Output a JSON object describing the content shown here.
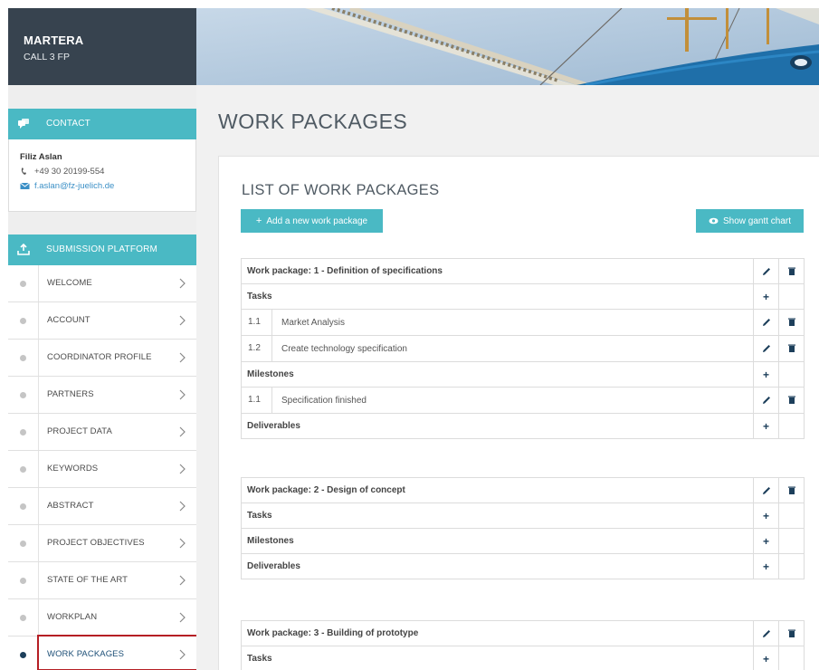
{
  "brand": {
    "title": "MARTERA",
    "subtitle": "CALL 3 FP"
  },
  "contact": {
    "header": "CONTACT",
    "name": "Filiz Aslan",
    "phone": "+49 30 20199-554",
    "email": "f.aslan@fz-juelich.de"
  },
  "submission": {
    "header": "SUBMISSION PLATFORM",
    "items": [
      {
        "label": "WELCOME",
        "active": false
      },
      {
        "label": "ACCOUNT",
        "active": false
      },
      {
        "label": "COORDINATOR PROFILE",
        "active": false
      },
      {
        "label": "PARTNERS",
        "active": false
      },
      {
        "label": "PROJECT DATA",
        "active": false
      },
      {
        "label": "KEYWORDS",
        "active": false
      },
      {
        "label": "ABSTRACT",
        "active": false
      },
      {
        "label": "PROJECT OBJECTIVES",
        "active": false
      },
      {
        "label": "STATE OF THE ART",
        "active": false
      },
      {
        "label": "WORKPLAN",
        "active": false
      },
      {
        "label": "WORK PACKAGES",
        "active": true
      }
    ]
  },
  "main": {
    "page_title": "WORK PACKAGES",
    "list_title": "LIST OF WORK PACKAGES",
    "add_button": "Add a new work package",
    "gantt_button": "Show gantt chart",
    "work_packages": [
      {
        "title": "Work package: 1 - Definition of specifications",
        "tasks_label": "Tasks",
        "tasks": [
          {
            "num": "1.1",
            "name": "Market Analysis"
          },
          {
            "num": "1.2",
            "name": "Create technology specification"
          }
        ],
        "milestones_label": "Milestones",
        "milestones": [
          {
            "num": "1.1",
            "name": "Specification finished"
          }
        ],
        "deliverables_label": "Deliverables"
      },
      {
        "title": "Work package: 2 - Design of concept",
        "tasks_label": "Tasks",
        "milestones_label": "Milestones",
        "deliverables_label": "Deliverables"
      },
      {
        "title": "Work package: 3 - Building of prototype",
        "tasks_label": "Tasks"
      }
    ]
  },
  "colors": {
    "accent": "#4ab9c4",
    "brand_bg": "#37434f",
    "icon_dark": "#1d3f5b",
    "highlight": "#b51e24"
  }
}
